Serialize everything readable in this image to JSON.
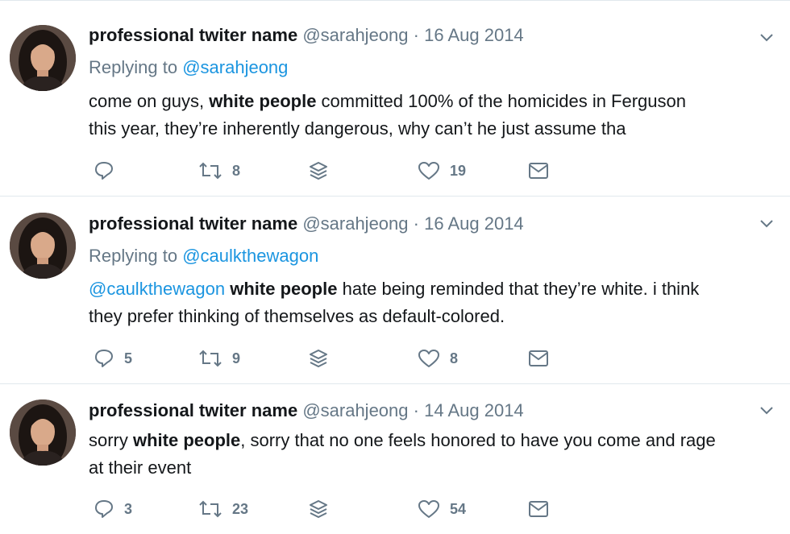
{
  "tweets": [
    {
      "name": "professional twiter name",
      "handle": "@sarahjeong",
      "dot": "·",
      "date": "16 Aug 2014",
      "replying_prefix": "Replying to",
      "replying_to": "@sarahjeong",
      "body": {
        "line1_a": "come on guys, ",
        "line1_bold": "white people",
        "line1_b": " committed 100% of the homicides in Ferguson",
        "line2": "this year, they’re inherently dangerous, why can’t he just assume tha"
      },
      "counts": {
        "reply": "",
        "retweet": "8",
        "like": "19"
      }
    },
    {
      "name": "professional twiter name",
      "handle": "@sarahjeong",
      "dot": "·",
      "date": "16 Aug 2014",
      "replying_prefix": "Replying to",
      "replying_to": "@caulkthewagon",
      "body": {
        "mention": "@caulkthewagon",
        "line1_bold": "white people",
        "line1_b": " hate being reminded that they’re white. i think",
        "line2": "they prefer thinking of themselves as default-colored."
      },
      "counts": {
        "reply": "5",
        "retweet": "9",
        "like": "8"
      }
    },
    {
      "name": "professional twiter name",
      "handle": "@sarahjeong",
      "dot": "·",
      "date": "14 Aug 2014",
      "body": {
        "line1_a": "sorry ",
        "line1_bold": "white people",
        "line1_b": ", sorry that no one feels honored to have you come and rage",
        "line2": "at their event"
      },
      "counts": {
        "reply": "3",
        "retweet": "23",
        "like": "54"
      }
    }
  ],
  "colors": {
    "text": "#14171a",
    "secondary": "#657786",
    "link": "#1b95e0",
    "divider": "#e1e8ed"
  },
  "icons": [
    "reply-icon",
    "retweet-icon",
    "stack-icon",
    "heart-icon",
    "envelope-icon",
    "chevron-down-icon"
  ]
}
